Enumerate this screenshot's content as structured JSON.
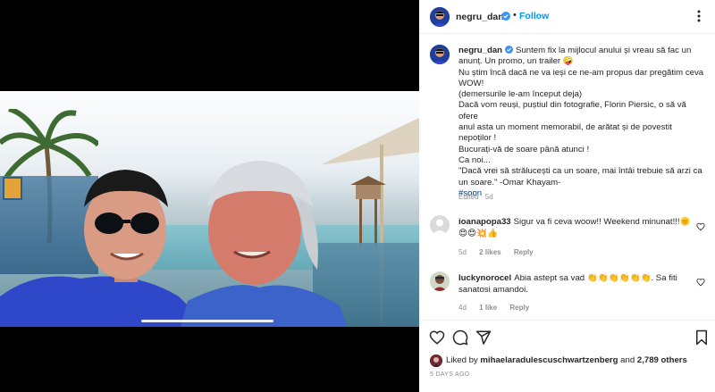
{
  "header": {
    "username": "negru_dan",
    "separator": "•",
    "follow_label": "Follow"
  },
  "caption": {
    "username": "negru_dan",
    "lines": [
      "Suntem fix la mijlocul anului și vreau să fac un",
      "anunț. Un promo, un trailer 🤪",
      "Nu știm încă dacă ne va ieși ce ne-am propus dar pregătim ceva",
      "WOW!",
      "(demersurile le-am început deja)",
      "Dacă vom reuși, puștiul din fotografie, Florin Piersic, o să vă ofere",
      "anul asta un moment memorabil, de arătat și de povestit",
      "nepoților !",
      "Bucurați-vă de soare până atunci !",
      "Ca noi...",
      "\"Dacă vrei să strălucești ca un soare, mai întâi trebuie să arzi ca",
      "un soare.\" -Omar Khayam-"
    ],
    "hashtag": "#soon",
    "meta": "Edited · 5d"
  },
  "comments": [
    {
      "username": "ioanapopa33",
      "text": "Sigur va fi ceva woow!! Weekend minunat!!!🌞",
      "text2": "😍😍💥👍",
      "age": "5d",
      "likes": "2 likes",
      "reply": "Reply"
    },
    {
      "username": "luckynorocel",
      "text": "Abia astept sa vad 👏👏👏👏👏👏. Sa fiti",
      "text2": "sanatosi amandoi.",
      "age": "4d",
      "likes": "1 like",
      "reply": "Reply"
    }
  ],
  "likes": {
    "prefix": "Liked by",
    "user": "mihaelaradulescuschwartzenberg",
    "and": "and",
    "others": "2,789 others"
  },
  "date": "5 DAYS AGO",
  "icons": {
    "like": "heart-icon",
    "comment": "comment-icon",
    "share": "share-icon",
    "save": "bookmark-icon",
    "more": "more-options-icon"
  },
  "colors": {
    "follow": "#0095f6",
    "muted": "#8e8e8e",
    "text": "#262626",
    "verified": "#3897f0",
    "hashtag": "#00376b"
  }
}
